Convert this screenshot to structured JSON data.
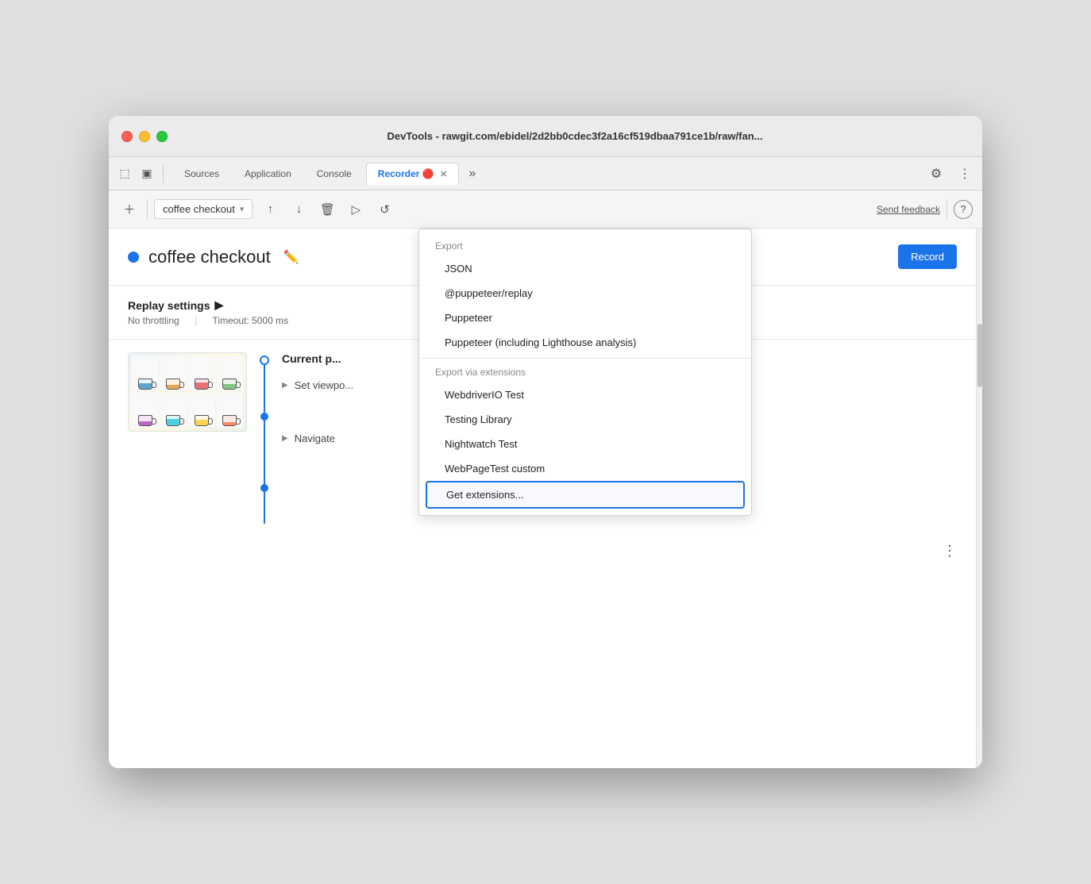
{
  "window": {
    "title": "DevTools - rawgit.com/ebidel/2d2bb0cdec3f2a16cf519dbaa791ce1b/raw/fan..."
  },
  "tabs": [
    {
      "label": "Sources",
      "active": false
    },
    {
      "label": "Application",
      "active": false
    },
    {
      "label": "Console",
      "active": false
    },
    {
      "label": "Recorder 🔴",
      "active": true
    }
  ],
  "toolbar": {
    "recording_name": "coffee checkout",
    "send_feedback": "Send feedback",
    "help": "?"
  },
  "recording": {
    "title": "coffee checkout",
    "record_button": "Record"
  },
  "replay_settings": {
    "title": "Replay settings",
    "arrow": "▶",
    "throttling": "No throttling",
    "timeout": "Timeout: 5000 ms"
  },
  "steps": {
    "current_page_label": "Current p...",
    "set_viewport_label": "Set viewpo...",
    "navigate_label": "Navigate"
  },
  "dropdown": {
    "export_label": "Export",
    "export_items": [
      {
        "id": "json",
        "label": "JSON"
      },
      {
        "id": "puppeteer-replay",
        "label": "@puppeteer/replay"
      },
      {
        "id": "puppeteer",
        "label": "Puppeteer"
      },
      {
        "id": "puppeteer-lighthouse",
        "label": "Puppeteer (including Lighthouse analysis)"
      }
    ],
    "export_via_extensions_label": "Export via extensions",
    "extension_items": [
      {
        "id": "webdriverio",
        "label": "WebdriverIO Test"
      },
      {
        "id": "testing-library",
        "label": "Testing Library"
      },
      {
        "id": "nightwatch",
        "label": "Nightwatch Test"
      },
      {
        "id": "webpagetest",
        "label": "WebPageTest custom"
      }
    ],
    "get_extensions_label": "Get extensions..."
  }
}
